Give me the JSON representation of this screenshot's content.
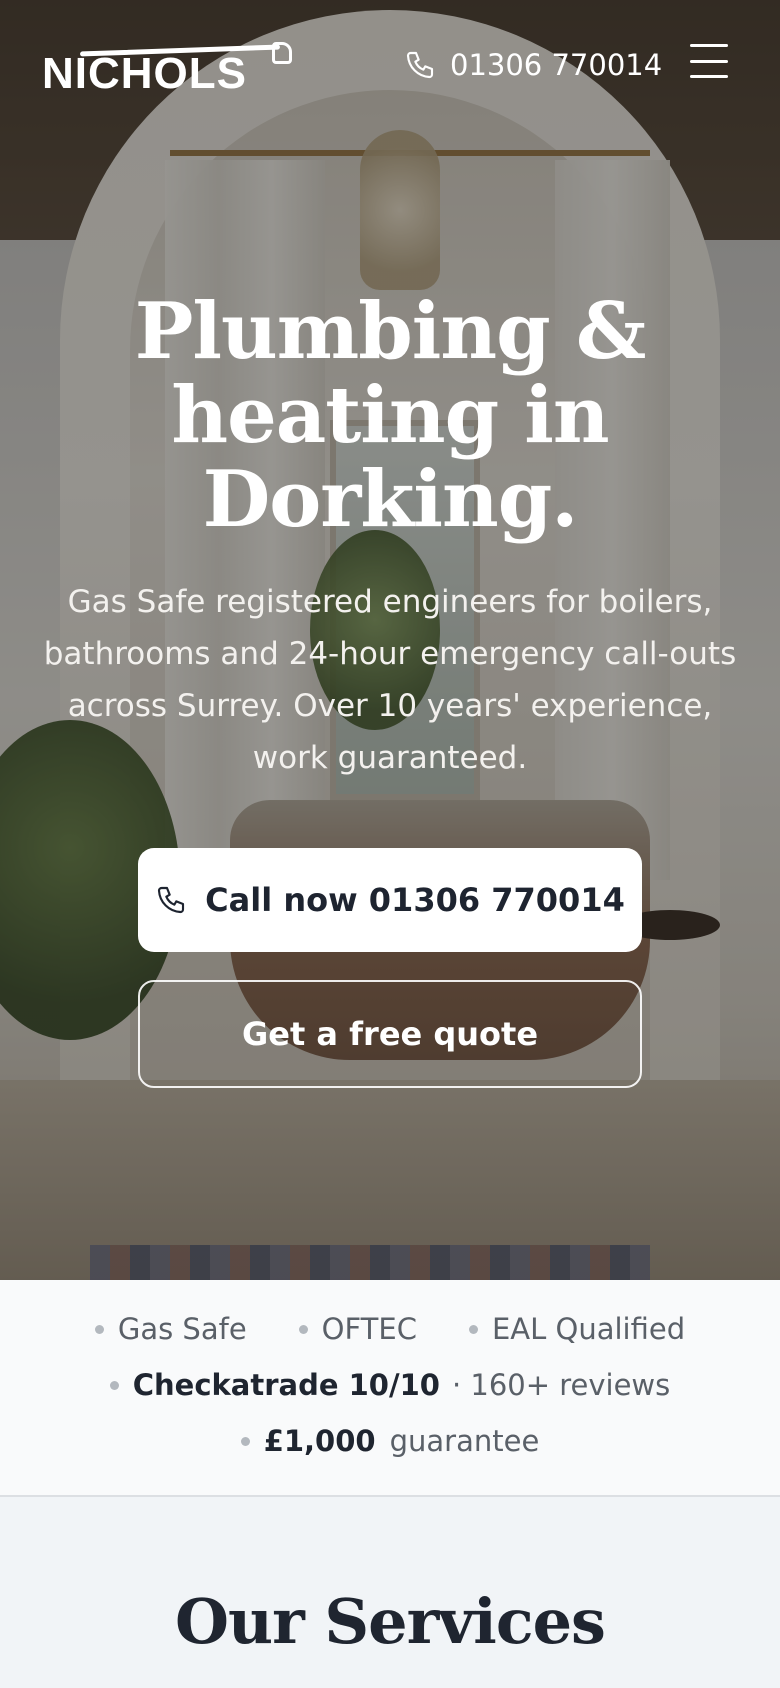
{
  "header": {
    "logo_text": "NICHOLS",
    "phone": "01306 770014"
  },
  "hero": {
    "title": "Plumbing & heating in Dorking.",
    "subtitle": "Gas Safe registered engineers for boilers, bathrooms and 24-hour emergency call-outs across Surrey. Over 10 years' experience, work guaranteed.",
    "call_button": "Call now 01306 770014",
    "quote_button": "Get a free quote"
  },
  "trust": {
    "row1": [
      "Gas Safe",
      "OFTEC",
      "EAL Qualified"
    ],
    "checkatrade": "Checkatrade 10/10",
    "reviews": "· 160+ reviews",
    "guarantee_amount": "£1,000",
    "guarantee_label": "guarantee"
  },
  "services": {
    "title": "Our Services"
  },
  "colors": {
    "primary_text": "#1f2530",
    "trust_bg": "#f9fafb",
    "page_bg": "#f1f4f7"
  },
  "icons": {
    "phone": "phone-icon",
    "menu": "hamburger-menu-icon"
  }
}
